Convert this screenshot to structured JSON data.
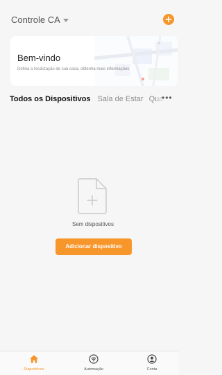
{
  "header": {
    "home_name": "Controle CA",
    "add_icon": "plus-circle-icon"
  },
  "welcome": {
    "title": "Bem-vindo",
    "subtitle": "Defina a localização de sua casa, obtenha mais informações"
  },
  "tabs": [
    {
      "label": "Todos os Dispositivos",
      "active": true
    },
    {
      "label": "Sala de Estar",
      "active": false
    },
    {
      "label": "Quarto",
      "active": false
    }
  ],
  "tabs_more": "•••",
  "empty_state": {
    "message": "Sem dispositivos",
    "button_label": "Adicionar dispositivo"
  },
  "bottom_nav": [
    {
      "label": "Dispositivos",
      "icon": "home-icon",
      "active": true
    },
    {
      "label": "Automação",
      "icon": "automation-icon",
      "active": false
    },
    {
      "label": "Conta",
      "icon": "account-icon",
      "active": false
    }
  ],
  "colors": {
    "accent": "#f7962b",
    "background": "#f6f6f6",
    "card": "#ffffff"
  }
}
